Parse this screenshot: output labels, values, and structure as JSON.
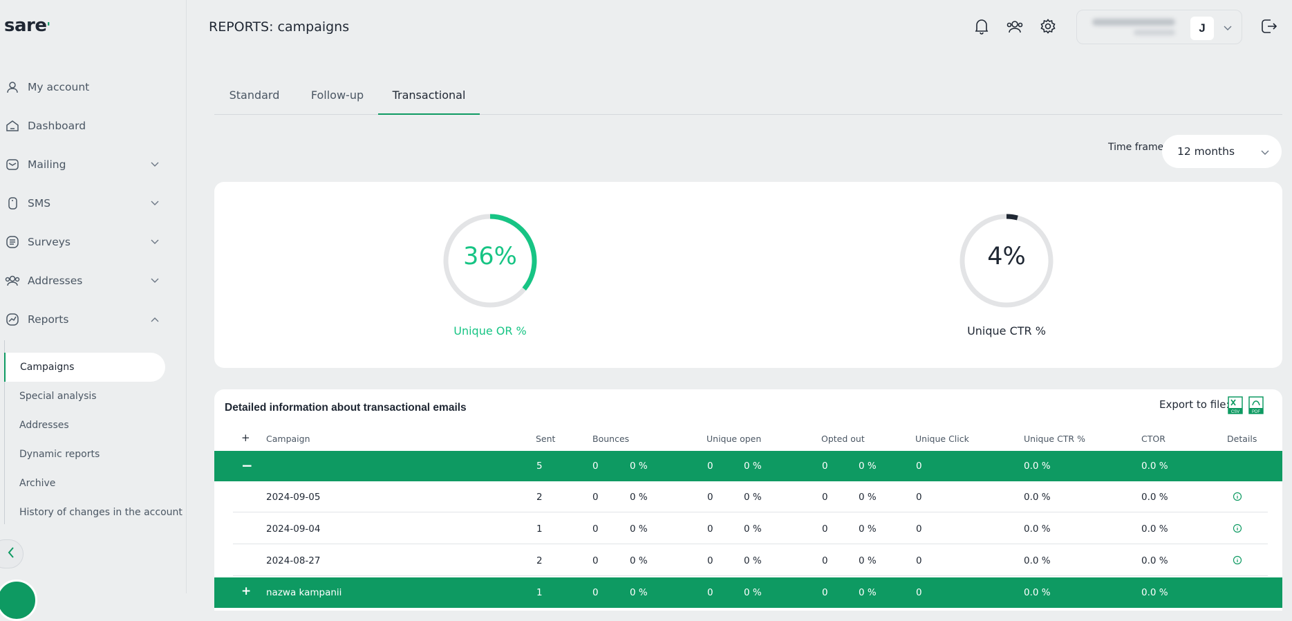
{
  "app": {
    "logo": "sare"
  },
  "sidebar": {
    "items": [
      {
        "label": "My account",
        "icon": "user-icon",
        "chevron": ""
      },
      {
        "label": "Dashboard",
        "icon": "home-icon",
        "chevron": ""
      },
      {
        "label": "Mailing",
        "icon": "mail-icon",
        "chevron": "down"
      },
      {
        "label": "SMS",
        "icon": "phone-icon",
        "chevron": "down"
      },
      {
        "label": "Surveys",
        "icon": "survey-icon",
        "chevron": "down"
      },
      {
        "label": "Addresses",
        "icon": "contacts-icon",
        "chevron": "down"
      },
      {
        "label": "Reports",
        "icon": "reports-icon",
        "chevron": "up"
      }
    ],
    "report_subitems": [
      {
        "label": "Campaigns",
        "active": true
      },
      {
        "label": "Special analysis"
      },
      {
        "label": "Addresses"
      },
      {
        "label": "Dynamic reports"
      },
      {
        "label": "Archive"
      },
      {
        "label": "History of changes in the account"
      }
    ]
  },
  "header": {
    "title": "REPORTS: campaigns",
    "avatar_initial": "J"
  },
  "tabs": [
    {
      "label": "Standard"
    },
    {
      "label": "Follow-up"
    },
    {
      "label": "Transactional",
      "active": true
    }
  ],
  "time_frame": {
    "label": "Time frame",
    "value": "12 months"
  },
  "stats": {
    "unique_or": {
      "value": "36%",
      "label": "Unique OR %",
      "fraction": 0.36,
      "color": "#17c484"
    },
    "unique_ctr": {
      "value": "4%",
      "label": "Unique CTR %",
      "fraction": 0.04,
      "color": "#1f2733"
    }
  },
  "table": {
    "title": "Detailed information about transactional emails",
    "export_label": "Export to file:",
    "export_formats": [
      "CSV",
      "PDF"
    ],
    "expand_all": "+",
    "columns": [
      "Campaign",
      "Sent",
      "Bounces",
      "Unique open",
      "Opted out",
      "Unique Click",
      "Unique CTR %",
      "CTOR",
      "Details"
    ],
    "group": {
      "toggle": "−",
      "campaign": "",
      "sent": "5",
      "bounces": "0",
      "bounces_pct": "0 %",
      "open": "0",
      "open_pct": "0 %",
      "opted": "0",
      "opted_pct": "0 %",
      "click": "0",
      "ctr": "0.0 %",
      "ctor": "0.0 %"
    },
    "rows": [
      {
        "campaign": "2024-09-05",
        "sent": "2",
        "bounces": "0",
        "bounces_pct": "0 %",
        "open": "0",
        "open_pct": "0 %",
        "opted": "0",
        "opted_pct": "0 %",
        "click": "0",
        "ctr": "0.0 %",
        "ctor": "0.0 %"
      },
      {
        "campaign": "2024-09-04",
        "sent": "1",
        "bounces": "0",
        "bounces_pct": "0 %",
        "open": "0",
        "open_pct": "0 %",
        "opted": "0",
        "opted_pct": "0 %",
        "click": "0",
        "ctr": "0.0 %",
        "ctor": "0.0 %"
      },
      {
        "campaign": "2024-08-27",
        "sent": "2",
        "bounces": "0",
        "bounces_pct": "0 %",
        "open": "0",
        "open_pct": "0 %",
        "opted": "0",
        "opted_pct": "0 %",
        "click": "0",
        "ctr": "0.0 %",
        "ctor": "0.0 %"
      }
    ],
    "group2": {
      "toggle": "+",
      "campaign": "nazwa kampanii",
      "sent": "1",
      "bounces": "0",
      "bounces_pct": "0 %",
      "open": "0",
      "open_pct": "0 %",
      "opted": "0",
      "opted_pct": "0 %",
      "click": "0",
      "ctr": "0.0 %",
      "ctor": "0.0 %"
    }
  }
}
